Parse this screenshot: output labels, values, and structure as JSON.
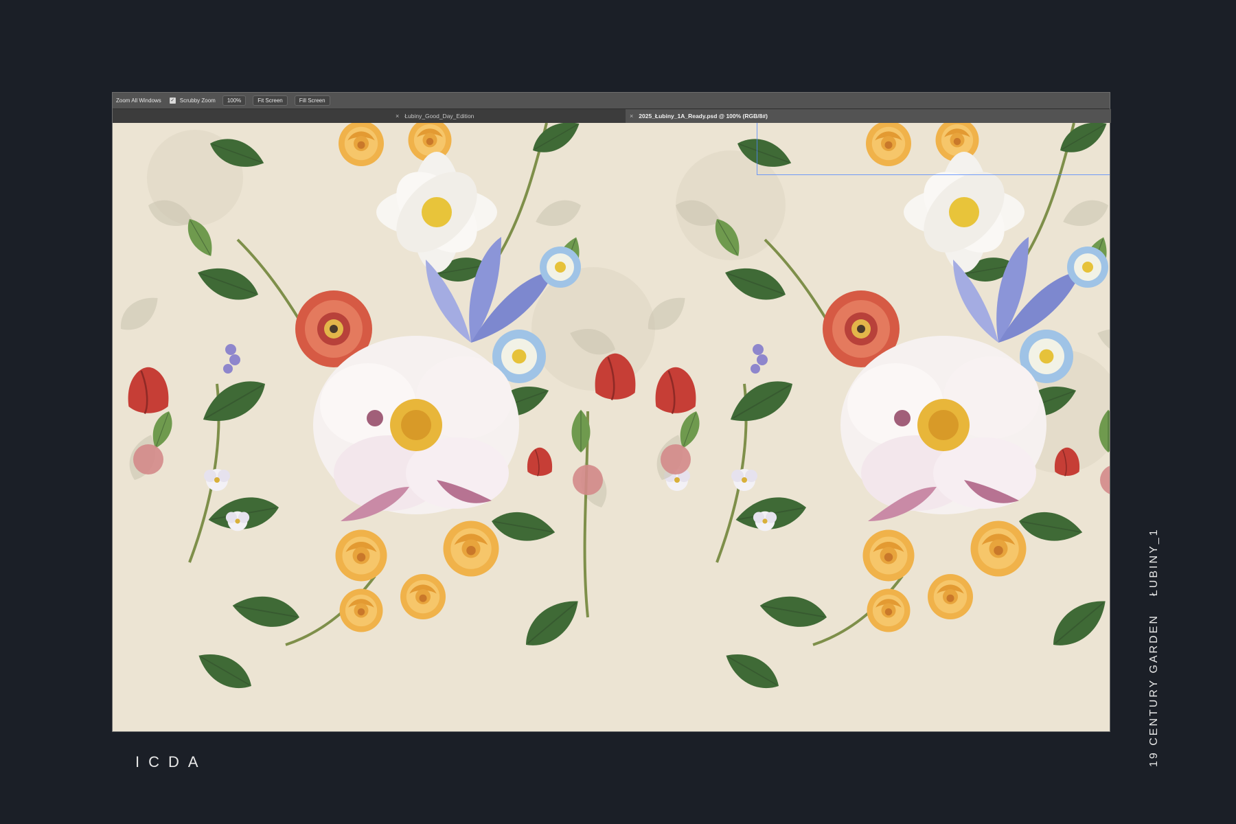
{
  "toolbar": {
    "zoom_all_windows": "Zoom All Windows",
    "scrubby_zoom": "Scrubby Zoom",
    "zoom_value": "100%",
    "fit_screen": "Fit Screen",
    "fill_screen": "Fill Screen"
  },
  "tabs": [
    {
      "label": "Łubiny_Good_Day_Edition",
      "close": "×",
      "active": false
    },
    {
      "label": "2025_Łubiny_1A_Ready.psd @ 100% (RGB/8#)",
      "close": "×",
      "active": true
    }
  ],
  "footer": {
    "brand": "ICDA",
    "collection": "19 CENTURY GARDEN",
    "pattern": "ŁUBINY_1"
  },
  "colors": {
    "background": "#1b1f27",
    "canvas_bg": "#ece4d3",
    "guide": "#4f86ff"
  }
}
